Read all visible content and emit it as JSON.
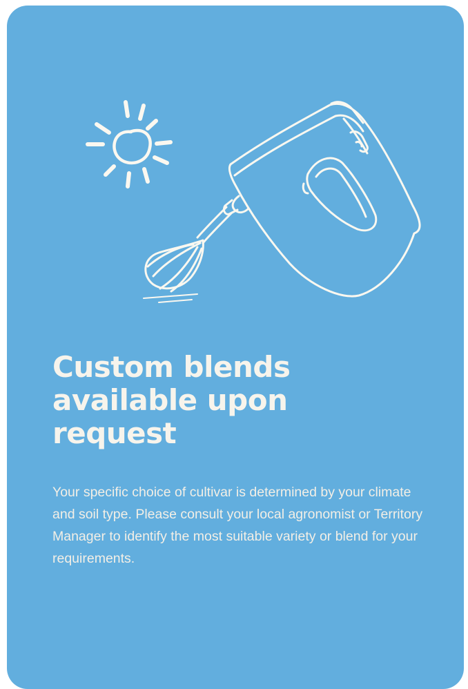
{
  "card": {
    "background_color": "#62aede",
    "text_color": "#f7f4ec",
    "headline": "Custom blends available upon request",
    "body": "Your specific choice of cultivar is determined by your climate and soil type. Please consult your local agronomist or Territory Manager to identify the most suitable variety or blend for your requirements."
  },
  "illustration": {
    "icons": [
      "sun-icon",
      "hand-mixer-icon"
    ]
  }
}
